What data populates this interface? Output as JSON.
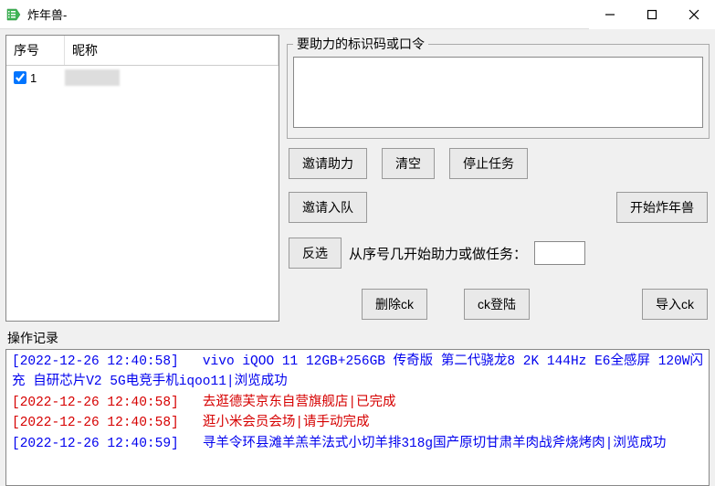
{
  "window": {
    "title": "炸年兽-"
  },
  "table": {
    "headers": {
      "seq": "序号",
      "nick": "昵称"
    },
    "rows": [
      {
        "checked": true,
        "seq": "1",
        "nick": ""
      }
    ]
  },
  "idcode": {
    "legend": "要助力的标识码或口令",
    "value": ""
  },
  "buttons": {
    "invite_help": "邀请助力",
    "clear": "清空",
    "stop_task": "停止任务",
    "invite_team": "邀请入队",
    "start_nian": "开始炸年兽",
    "invert_sel": "反选",
    "delete_ck": "删除ck",
    "ck_login": "ck登陆",
    "import_ck": "导入ck"
  },
  "seq_start": {
    "label": "从序号几开始助力或做任务：",
    "value": ""
  },
  "log": {
    "label": "操作记录",
    "lines": [
      {
        "color": "blue",
        "text": "[2022-12-26 12:40:58]   vivo iQOO 11 12GB+256GB 传奇版 第二代骁龙8 2K 144Hz E6全感屏 120W闪充 自研芯片V2 5G电竞手机iqoo11|浏览成功"
      },
      {
        "color": "red",
        "text": "[2022-12-26 12:40:58]   去逛德芙京东自营旗舰店|已完成"
      },
      {
        "color": "red",
        "text": "[2022-12-26 12:40:58]   逛小米会员会场|请手动完成"
      },
      {
        "color": "blue",
        "text": "[2022-12-26 12:40:59]   寻羊令环县滩羊羔羊法式小切羊排318g国产原切甘肃羊肉战斧烧烤肉|浏览成功"
      }
    ]
  }
}
